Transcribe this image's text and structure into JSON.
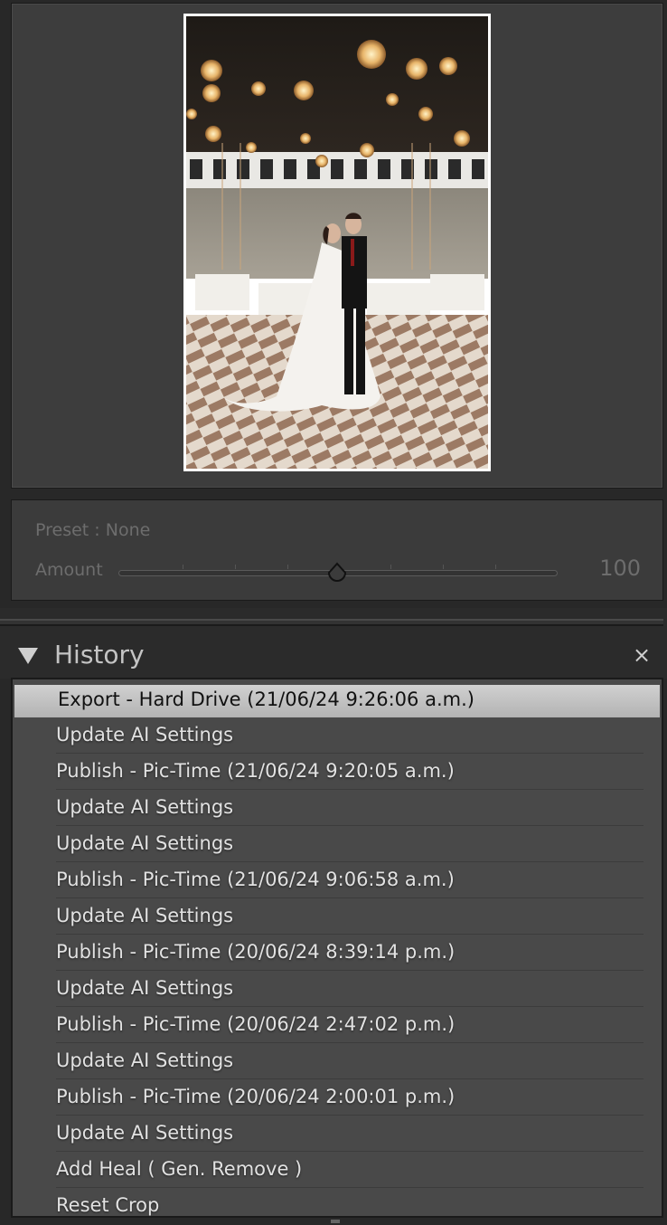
{
  "navigator": {
    "preview_alt": "Wedding couple photo preview"
  },
  "preset": {
    "label": "Preset : None",
    "amount_label": "Amount",
    "amount_value": "100",
    "amount_fraction": 0.5
  },
  "history": {
    "title": "History",
    "clear_icon": "×",
    "items": [
      {
        "label": "Export - Hard Drive (21/06/24 9:26:06 a.m.)",
        "selected": true
      },
      {
        "label": "Update AI Settings"
      },
      {
        "label": "Publish - Pic-Time (21/06/24 9:20:05 a.m.)"
      },
      {
        "label": "Update AI Settings"
      },
      {
        "label": "Update AI Settings"
      },
      {
        "label": "Publish - Pic-Time (21/06/24 9:06:58 a.m.)"
      },
      {
        "label": "Update AI Settings"
      },
      {
        "label": "Publish - Pic-Time (20/06/24 8:39:14 p.m.)"
      },
      {
        "label": "Update AI Settings"
      },
      {
        "label": "Publish - Pic-Time (20/06/24 2:47:02 p.m.)"
      },
      {
        "label": "Update AI Settings"
      },
      {
        "label": "Publish - Pic-Time (20/06/24 2:00:01 p.m.)"
      },
      {
        "label": "Update AI Settings"
      },
      {
        "label": "Add Heal ( Gen. Remove )"
      },
      {
        "label": "Reset Crop"
      }
    ]
  },
  "colors": {
    "panel_bg": "#3d3d3d",
    "list_bg": "#494949",
    "selected_bg": "#c7c7c7",
    "text": "#e2e2e2"
  }
}
